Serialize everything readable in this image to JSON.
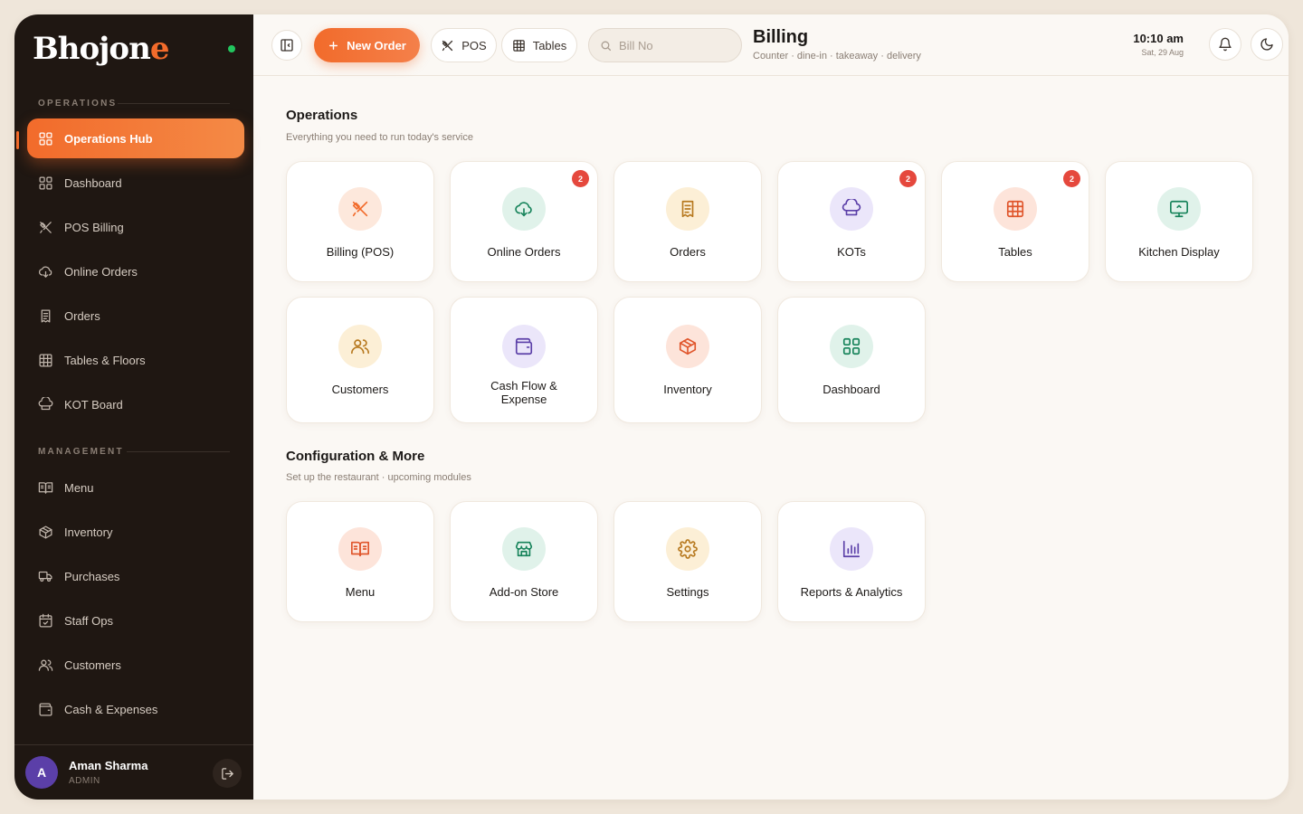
{
  "app": {
    "brand_main": "Bhojon",
    "brand_accent": "e"
  },
  "sidebar": {
    "operations_label": "OPERATIONS",
    "management_label": "MANAGEMENT",
    "operations": [
      {
        "label": "Operations Hub",
        "icon": "grid-icon",
        "active": true
      },
      {
        "label": "Dashboard",
        "icon": "grid-icon"
      },
      {
        "label": "POS Billing",
        "icon": "utensils-icon"
      },
      {
        "label": "Online Orders",
        "icon": "cloud-icon"
      },
      {
        "label": "Orders",
        "icon": "receipt-icon"
      },
      {
        "label": "Tables & Floors",
        "icon": "table-icon"
      },
      {
        "label": "KOT Board",
        "icon": "chef-hat-icon"
      }
    ],
    "management": [
      {
        "label": "Menu",
        "icon": "book-icon"
      },
      {
        "label": "Inventory",
        "icon": "box-icon"
      },
      {
        "label": "Purchases",
        "icon": "truck-icon"
      },
      {
        "label": "Staff Ops",
        "icon": "calendar-icon"
      },
      {
        "label": "Customers",
        "icon": "users-icon"
      },
      {
        "label": "Cash & Expenses",
        "icon": "wallet-icon"
      }
    ],
    "user": {
      "initial": "A",
      "name": "Aman Sharma",
      "role": "ADMIN"
    }
  },
  "topbar": {
    "new_order_label": "New Order",
    "pos_label": "POS",
    "tables_label": "Tables",
    "search_placeholder": "Bill No",
    "title": "Billing",
    "subtitle": "Counter · dine-in · takeaway · delivery",
    "time": "10:10 am",
    "date": "Sat, 29 Aug"
  },
  "operations_section": {
    "title": "Operations",
    "subtitle": "Everything you need to run today's service",
    "tiles": [
      {
        "label": "Billing (POS)",
        "icon": "utensils-icon",
        "color": "#f26b2b",
        "bg": "#fde8dc",
        "badge": ""
      },
      {
        "label": "Online Orders",
        "icon": "cloud-icon",
        "color": "#16835a",
        "bg": "#e0f2ea",
        "badge": "2"
      },
      {
        "label": "Orders",
        "icon": "receipt-icon",
        "color": "#b7791f",
        "bg": "#fcefd6",
        "badge": ""
      },
      {
        "label": "KOTs",
        "icon": "chef-hat-icon",
        "color": "#5b3fa8",
        "bg": "#ebe6fa",
        "badge": "2"
      },
      {
        "label": "Tables",
        "icon": "table-icon",
        "color": "#e0552b",
        "bg": "#fde4da",
        "badge": "2"
      },
      {
        "label": "Kitchen Display",
        "icon": "monitor-icon",
        "color": "#16835a",
        "bg": "#e0f2ea",
        "badge": ""
      },
      {
        "label": "Customers",
        "icon": "users-icon",
        "color": "#b7791f",
        "bg": "#fcefd6",
        "badge": ""
      },
      {
        "label": "Cash Flow & Expense",
        "icon": "wallet-icon",
        "color": "#5b3fa8",
        "bg": "#ebe6fa",
        "badge": ""
      },
      {
        "label": "Inventory",
        "icon": "box-icon",
        "color": "#e0552b",
        "bg": "#fde4da",
        "badge": ""
      },
      {
        "label": "Dashboard",
        "icon": "grid-icon",
        "color": "#16835a",
        "bg": "#e0f2ea",
        "badge": ""
      }
    ]
  },
  "config_section": {
    "title": "Configuration & More",
    "subtitle": "Set up the restaurant · upcoming modules",
    "tiles": [
      {
        "label": "Menu",
        "icon": "book-icon",
        "color": "#e0552b",
        "bg": "#fde4da"
      },
      {
        "label": "Add-on Store",
        "icon": "store-icon",
        "color": "#16835a",
        "bg": "#e0f2ea"
      },
      {
        "label": "Settings",
        "icon": "gear-icon",
        "color": "#b7791f",
        "bg": "#fcefd6"
      },
      {
        "label": "Reports & Analytics",
        "icon": "bar-chart-icon",
        "color": "#5b3fa8",
        "bg": "#ebe6fa"
      }
    ]
  }
}
